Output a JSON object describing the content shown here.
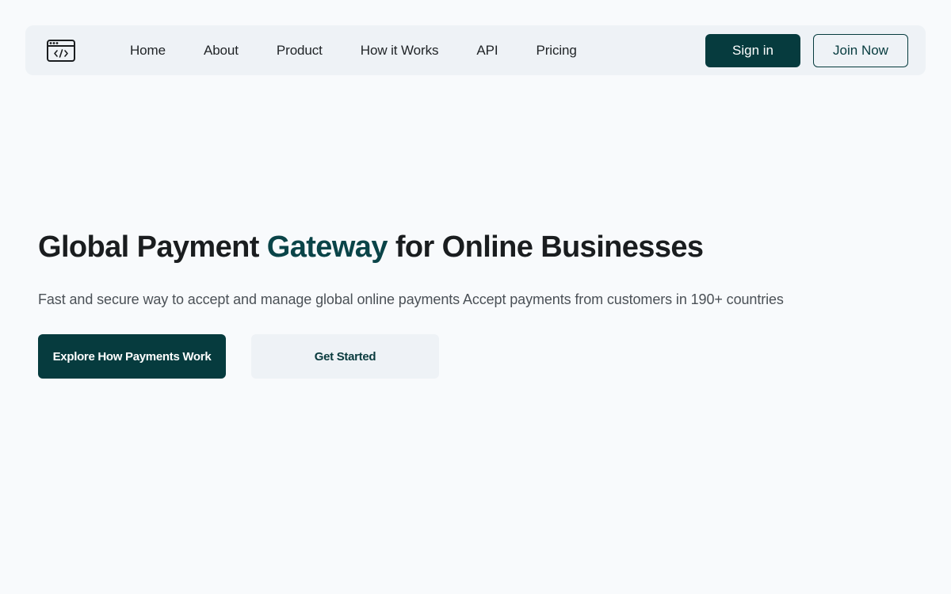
{
  "colors": {
    "page_background": "#f8fafc",
    "navbar_background": "#eef2f6",
    "primary": "#063b3e",
    "accent_text": "#0a4448",
    "heading_text": "#1a1d1f",
    "body_text": "#4b5157"
  },
  "navbar": {
    "logo_icon": "code-window-icon",
    "links": [
      {
        "label": "Home"
      },
      {
        "label": "About"
      },
      {
        "label": "Product"
      },
      {
        "label": "How it Works"
      },
      {
        "label": "API"
      },
      {
        "label": "Pricing"
      }
    ],
    "signin_label": "Sign in",
    "join_label": "Join Now"
  },
  "hero": {
    "title_prefix": "Global Payment ",
    "title_accent": "Gateway",
    "title_suffix": " for Online Businesses",
    "subtitle": "Fast and secure way to accept and manage global online payments Accept payments from customers in 190+ countries",
    "primary_cta": "Explore How Payments Work",
    "secondary_cta": "Get Started"
  }
}
